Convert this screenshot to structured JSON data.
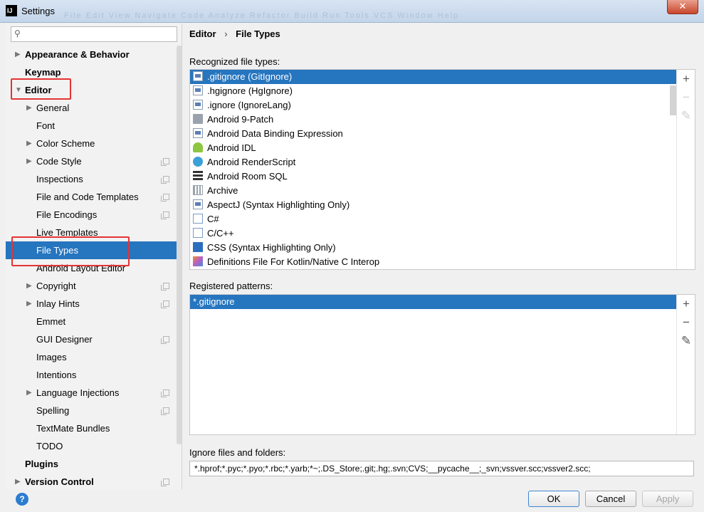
{
  "window": {
    "title": "Settings",
    "app_logo": "IJ",
    "close_label": "✕",
    "ghost_menu": "File  Edit  View  Navigate  Code  Analyze  Refactor  Build  Run  Tools  VCS  Window  Help"
  },
  "search": {
    "value": "",
    "placeholder": ""
  },
  "tree": [
    {
      "label": "Appearance & Behavior",
      "level": 0,
      "arrow": "right",
      "copy": false
    },
    {
      "label": "Keymap",
      "level": 0,
      "arrow": "",
      "copy": false
    },
    {
      "label": "Editor",
      "level": 0,
      "arrow": "down",
      "copy": false
    },
    {
      "label": "General",
      "level": 1,
      "arrow": "right",
      "copy": false
    },
    {
      "label": "Font",
      "level": 1,
      "arrow": "",
      "copy": false
    },
    {
      "label": "Color Scheme",
      "level": 1,
      "arrow": "right",
      "copy": false
    },
    {
      "label": "Code Style",
      "level": 1,
      "arrow": "right",
      "copy": true
    },
    {
      "label": "Inspections",
      "level": 1,
      "arrow": "",
      "copy": true
    },
    {
      "label": "File and Code Templates",
      "level": 1,
      "arrow": "",
      "copy": true
    },
    {
      "label": "File Encodings",
      "level": 1,
      "arrow": "",
      "copy": true
    },
    {
      "label": "Live Templates",
      "level": 1,
      "arrow": "",
      "copy": false
    },
    {
      "label": "File Types",
      "level": 1,
      "arrow": "",
      "copy": false,
      "selected": true
    },
    {
      "label": "Android Layout Editor",
      "level": 1,
      "arrow": "",
      "copy": false
    },
    {
      "label": "Copyright",
      "level": 1,
      "arrow": "right",
      "copy": true
    },
    {
      "label": "Inlay Hints",
      "level": 1,
      "arrow": "right",
      "copy": true
    },
    {
      "label": "Emmet",
      "level": 1,
      "arrow": "",
      "copy": false
    },
    {
      "label": "GUI Designer",
      "level": 1,
      "arrow": "",
      "copy": true
    },
    {
      "label": "Images",
      "level": 1,
      "arrow": "",
      "copy": false
    },
    {
      "label": "Intentions",
      "level": 1,
      "arrow": "",
      "copy": false
    },
    {
      "label": "Language Injections",
      "level": 1,
      "arrow": "right",
      "copy": true
    },
    {
      "label": "Spelling",
      "level": 1,
      "arrow": "",
      "copy": true
    },
    {
      "label": "TextMate Bundles",
      "level": 1,
      "arrow": "",
      "copy": false
    },
    {
      "label": "TODO",
      "level": 1,
      "arrow": "",
      "copy": false
    },
    {
      "label": "Plugins",
      "level": 0,
      "arrow": "",
      "copy": false
    },
    {
      "label": "Version Control",
      "level": 0,
      "arrow": "right",
      "copy": true
    }
  ],
  "breadcrumb": {
    "parent": "Editor",
    "separator": "›",
    "current": "File Types"
  },
  "recognized": {
    "label": "Recognized file types:",
    "items": [
      {
        "label": ".gitignore (GitIgnore)",
        "icon": "doc",
        "selected": true
      },
      {
        "label": ".hgignore (HgIgnore)",
        "icon": "doc"
      },
      {
        "label": ".ignore (IgnoreLang)",
        "icon": "doc"
      },
      {
        "label": "Android 9-Patch",
        "icon": "folder"
      },
      {
        "label": "Android Data Binding Expression",
        "icon": "doc"
      },
      {
        "label": "Android IDL",
        "icon": "android"
      },
      {
        "label": "Android RenderScript",
        "icon": "rs"
      },
      {
        "label": "Android Room SQL",
        "icon": "sql"
      },
      {
        "label": "Archive",
        "icon": "archive"
      },
      {
        "label": "AspectJ (Syntax Highlighting Only)",
        "icon": "doc"
      },
      {
        "label": "C#",
        "icon": "c"
      },
      {
        "label": "C/C++",
        "icon": "c"
      },
      {
        "label": "CSS (Syntax Highlighting Only)",
        "icon": "css"
      },
      {
        "label": "Definitions File For Kotlin/Native C Interop",
        "icon": "kotlin"
      }
    ]
  },
  "patterns": {
    "label": "Registered patterns:",
    "items": [
      {
        "label": "*.gitignore",
        "selected": true
      }
    ]
  },
  "tools": {
    "add": "+",
    "remove": "−",
    "edit": "✎"
  },
  "ignore": {
    "label": "Ignore files and folders:",
    "value": "*.hprof;*.pyc;*.pyo;*.rbc;*.yarb;*~;.DS_Store;.git;.hg;.svn;CVS;__pycache__;_svn;vssver.scc;vssver2.scc;"
  },
  "buttons": {
    "ok": "OK",
    "cancel": "Cancel",
    "apply": "Apply",
    "help": "?"
  },
  "colors": {
    "selection": "#2675bf",
    "highlight": "#e53333"
  }
}
